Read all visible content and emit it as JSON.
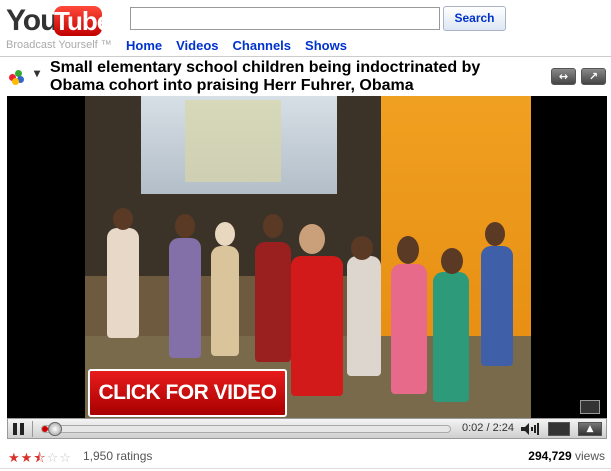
{
  "header": {
    "logo_you": "You",
    "logo_tube": "Tube",
    "tagline": "Broadcast Yourself ™",
    "search_placeholder": "",
    "search_button": "Search",
    "nav": [
      "Home",
      "Videos",
      "Channels",
      "Shows"
    ]
  },
  "video": {
    "title": "Small elementary school children being indoctrinated by Obama cohort into praising Herr Fuhrer, Obama",
    "overlay_label": "CLICK FOR VIDEO",
    "time_display": "0:02 / 2:24",
    "progress_fraction": 0.014
  },
  "stats": {
    "rating_stars": 2.5,
    "ratings_text": "1,950 ratings",
    "views_count": "294,729",
    "views_label": " views"
  },
  "colors": {
    "brand_red": "#cc0000",
    "link_blue": "#0033cc",
    "star_red": "#d6312b"
  },
  "icons": [
    "pause-icon",
    "volume-icon",
    "fullscreen-icon",
    "resize-icon",
    "popout-icon",
    "color-balls-icon"
  ]
}
